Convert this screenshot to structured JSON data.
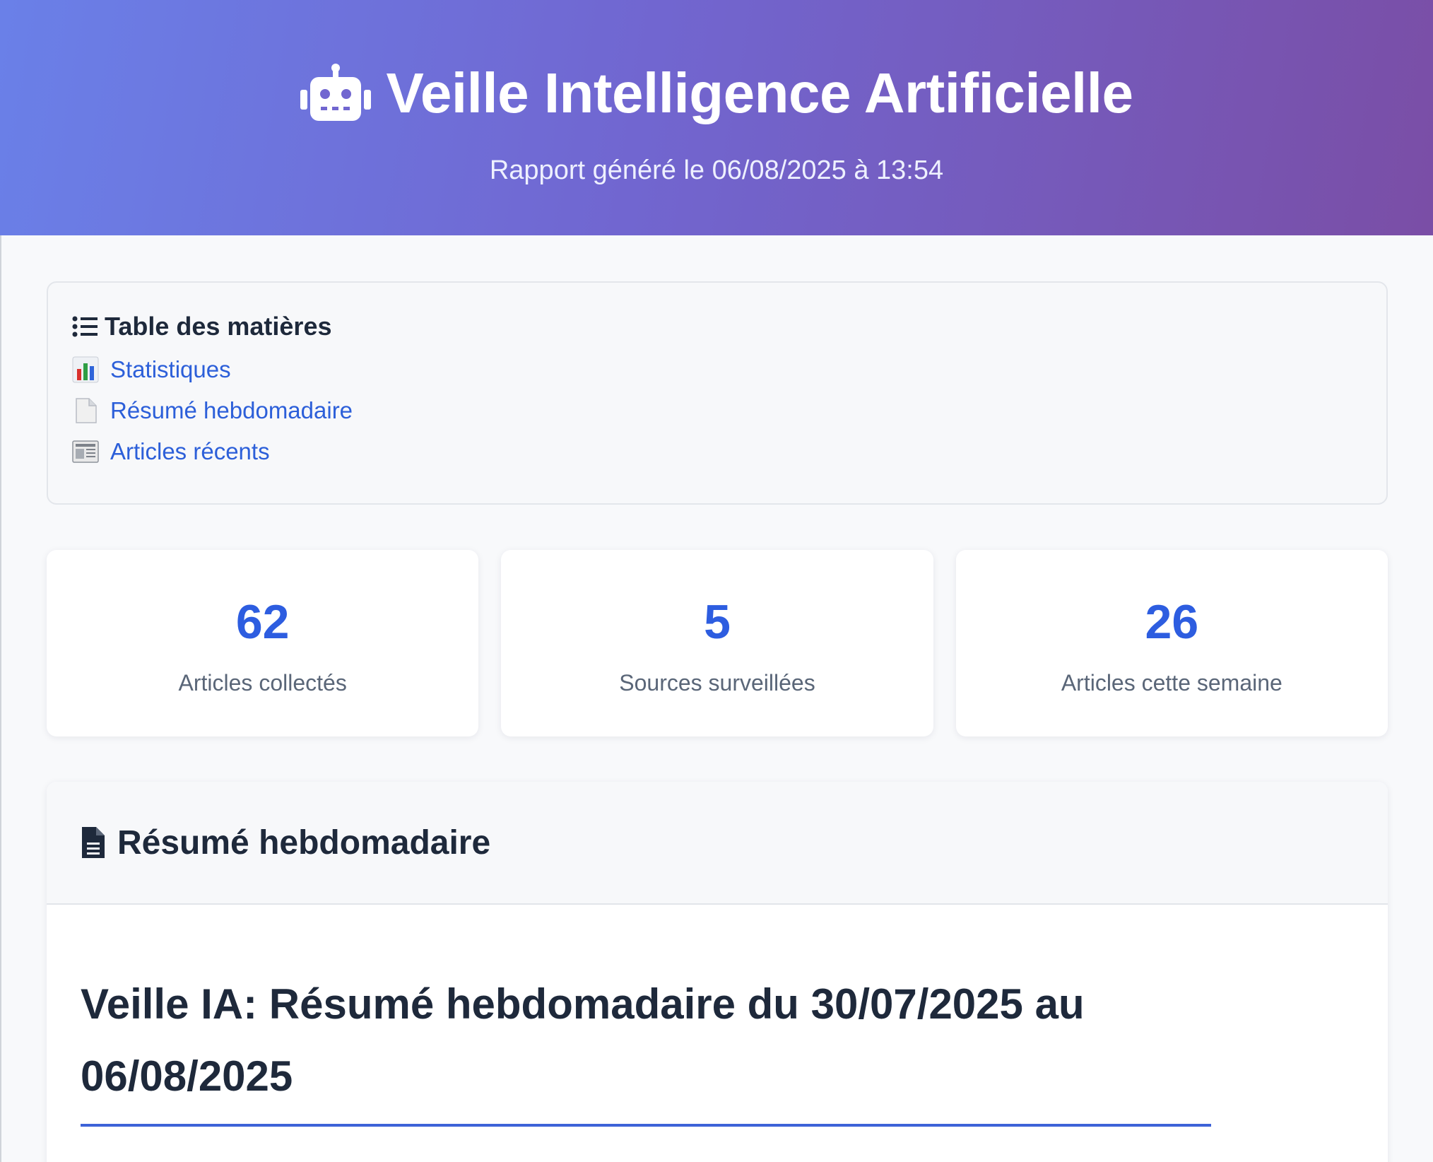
{
  "header": {
    "title": "Veille Intelligence Artificielle",
    "subtitle": "Rapport généré le 06/08/2025 à 13:54",
    "icon": "robot-icon"
  },
  "toc": {
    "title": "Table des matières",
    "icon": "list-icon",
    "items": [
      {
        "label": "Statistiques",
        "icon": "bar-chart-emoji"
      },
      {
        "label": "Résumé hebdomadaire",
        "icon": "page-emoji"
      },
      {
        "label": "Articles récents",
        "icon": "newspaper-emoji"
      }
    ]
  },
  "stats": [
    {
      "value": "62",
      "label": "Articles collectés"
    },
    {
      "value": "5",
      "label": "Sources surveillées"
    },
    {
      "value": "26",
      "label": "Articles cette semaine"
    }
  ],
  "summary": {
    "title": "Résumé hebdomadaire",
    "icon": "document-icon",
    "heading": "Veille IA: Résumé hebdomadaire du 30/07/2025 au 06/08/2025"
  },
  "colors": {
    "header_gradient_start": "#6a80e8",
    "header_gradient_end": "#7a4ea6",
    "accent": "#2d5de0",
    "link": "#2c5fd9"
  }
}
